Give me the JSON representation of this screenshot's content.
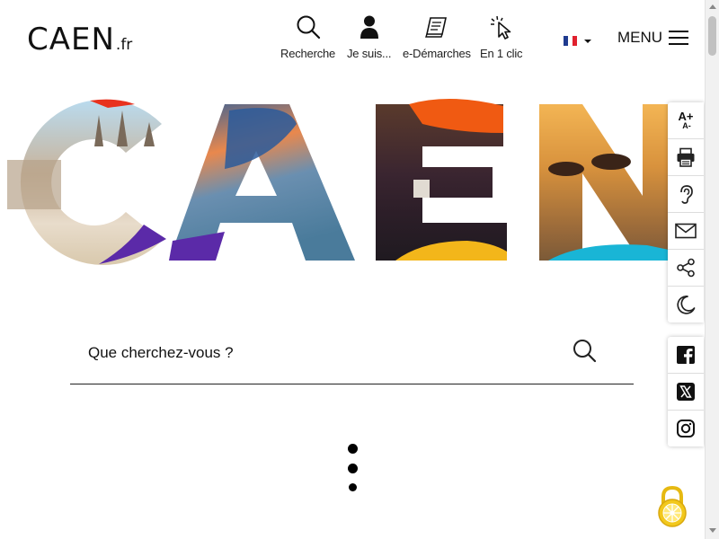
{
  "header": {
    "logo": {
      "main": "CAEN",
      "suffix": ".fr"
    },
    "nav": [
      {
        "label": "Recherche",
        "icon": "search-icon"
      },
      {
        "label": "Je suis...",
        "icon": "user-icon"
      },
      {
        "label": "e-Démarches",
        "icon": "document-icon"
      },
      {
        "label": "En 1 clic",
        "icon": "cursor-click-icon"
      }
    ],
    "language": {
      "icon": "french-flag-icon",
      "colors": [
        "#1f3b8f",
        "#ffffff",
        "#e0202e"
      ]
    },
    "menu_label": "MENU"
  },
  "hero": {
    "word": "CAEN"
  },
  "search": {
    "placeholder": "Que cherchez-vous ?"
  },
  "toolbar": {
    "font_size": {
      "increase": "A+",
      "decrease": "A-"
    },
    "tools": [
      "print-icon",
      "hearing-icon",
      "mail-icon",
      "share-icon",
      "dark-mode-icon"
    ],
    "social": [
      "facebook-icon",
      "x-twitter-icon",
      "instagram-icon"
    ]
  },
  "colors": {
    "orange": "#f05a12",
    "purple": "#5b2aa8",
    "yellow": "#f3b61a",
    "cyan": "#19b5d6",
    "lock_yellow": "#f2c81c"
  }
}
